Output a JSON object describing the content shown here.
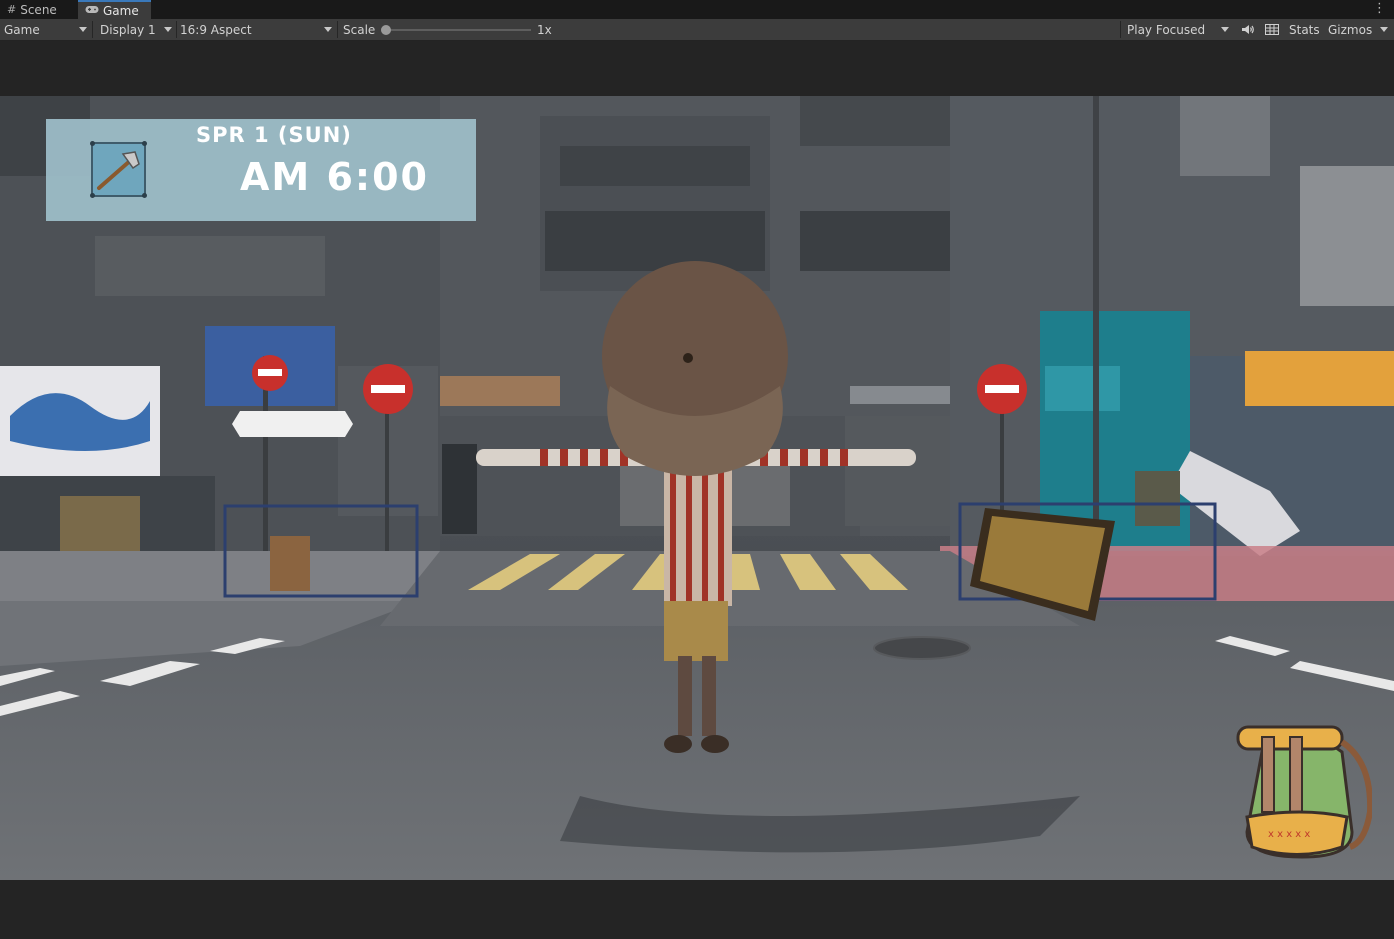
{
  "tabs": [
    {
      "label": "Scene",
      "icon": "grid-icon",
      "active": false
    },
    {
      "label": "Game",
      "icon": "gamepad-icon",
      "active": true
    }
  ],
  "toolbar": {
    "view_mode": "Game",
    "display": "Display 1",
    "aspect": "16:9 Aspect",
    "scale_label": "Scale",
    "scale_value": "1x",
    "scale_level": 0,
    "play_mode": "Play Focused",
    "stats_label": "Stats",
    "gizmos_label": "Gizmos",
    "icons": [
      "audio-mute-icon",
      "stats-grid-icon",
      "kebab-menu-icon"
    ]
  },
  "hud": {
    "date": "SPR 1 (SUN)",
    "time": "AM 6:00",
    "equipped_tool_icon": "axe-icon"
  },
  "inventory": {
    "icon": "backpack-icon"
  },
  "colors": {
    "editor_bg": "#191919",
    "toolbar_bg": "#3c3c3c",
    "active_tab_accent": "#3a79bb",
    "hud_bg": "#9ebec9",
    "hud_slot": "#6fa6bd"
  }
}
